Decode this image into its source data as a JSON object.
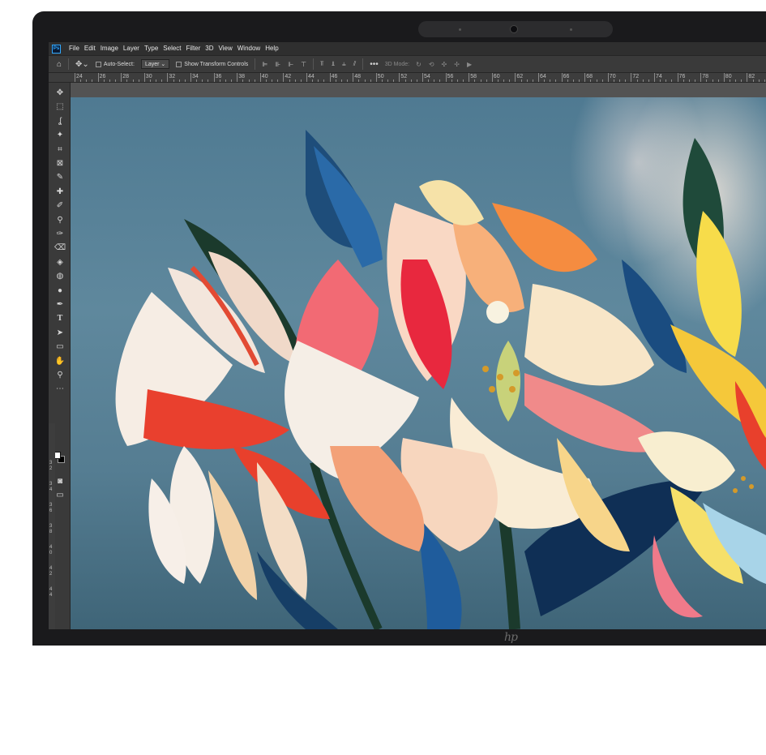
{
  "app": {
    "logo_text": "Ps",
    "menu": [
      "File",
      "Edit",
      "Image",
      "Layer",
      "Type",
      "Select",
      "Filter",
      "3D",
      "View",
      "Window",
      "Help"
    ]
  },
  "options_bar": {
    "auto_select_label": "Auto-Select:",
    "auto_select_value": "Layer",
    "show_transform_label": "Show Transform Controls",
    "mode_3d_label": "3D Mode:"
  },
  "ruler": {
    "horizontal": [
      "24",
      "26",
      "28",
      "30",
      "32",
      "34",
      "36",
      "38",
      "40",
      "42",
      "44",
      "46",
      "48",
      "50",
      "52",
      "54",
      "56",
      "58",
      "60",
      "62",
      "64",
      "66",
      "68",
      "70",
      "72",
      "74",
      "76",
      "78",
      "80",
      "82"
    ],
    "vertical": [
      "3",
      "2",
      "3",
      "4",
      "3",
      "6",
      "3",
      "8",
      "4",
      "0",
      "4",
      "2",
      "4",
      "4"
    ]
  },
  "toolbar": {
    "tools": [
      "move-tool",
      "marquee-tool",
      "lasso-tool",
      "magic-wand-tool",
      "crop-tool",
      "frame-tool",
      "eyedropper-tool",
      "healing-tool",
      "brush-tool",
      "stamp-tool",
      "history-brush-tool",
      "eraser-tool",
      "gradient-tool",
      "blur-tool",
      "dodge-tool",
      "pen-tool",
      "type-tool",
      "path-selection-tool",
      "rectangle-tool",
      "hand-tool",
      "zoom-tool",
      "more-tools"
    ],
    "foreground_color": "#ffffff",
    "background_color": "#000000"
  },
  "device": {
    "brand_logo": "hp"
  },
  "colors": {
    "ui_dark": "#2f2f2f",
    "ui_panel": "#3a3a3a",
    "canvas_blue": "#5f889d"
  }
}
